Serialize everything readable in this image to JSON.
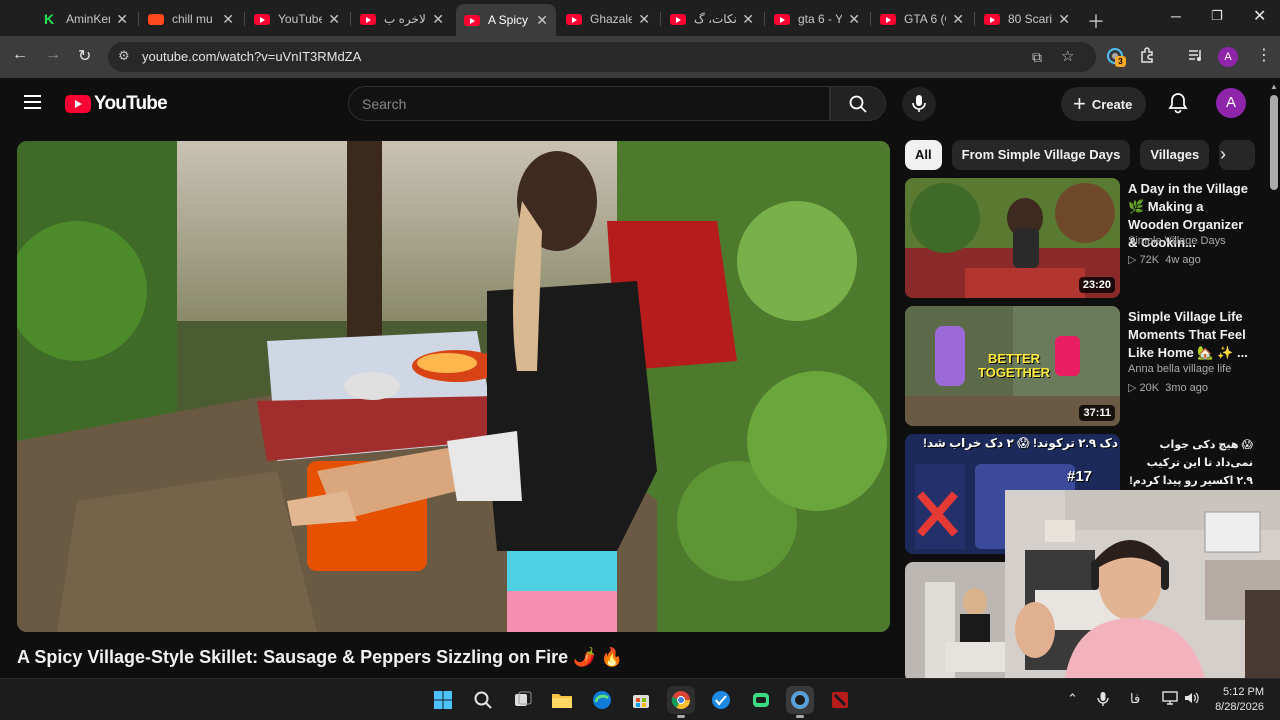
{
  "browser": {
    "tabs": [
      {
        "title": "AminKen",
        "icon": "k-icon"
      },
      {
        "title": "chill mu",
        "icon": "soundcloud-icon"
      },
      {
        "title": "YouTube",
        "icon": "youtube-icon"
      },
      {
        "title": "بالاخره ب",
        "icon": "youtube-icon"
      },
      {
        "title": "A Spicy",
        "icon": "youtube-icon"
      },
      {
        "title": "Ghazale",
        "icon": "youtube-icon"
      },
      {
        "title": "آنکات، گ",
        "icon": "youtube-icon"
      },
      {
        "title": "gta 6 - Y",
        "icon": "youtube-icon"
      },
      {
        "title": "GTA 6 (C",
        "icon": "youtube-icon"
      },
      {
        "title": "80 Scari",
        "icon": "youtube-icon"
      }
    ],
    "active_tab_index": 4,
    "url": "youtube.com/watch?v=uVnIT3RMdZA",
    "extensions_badge": "3",
    "profile_initial": "A"
  },
  "youtube": {
    "logo_text": "YouTube",
    "search_placeholder": "Search",
    "create_label": "Create",
    "avatar_initial": "A",
    "video_title": "A Spicy Village-Style Skillet: Sausage & Peppers Sizzling on Fire 🌶️ 🔥",
    "chips": [
      "All",
      "From Simple Village Days",
      "Villages"
    ],
    "recommendations": [
      {
        "title": "A Day in the Village 🌿 Making a Wooden Organizer & Cookin...",
        "channel": "Simple Village Days",
        "views": "72K",
        "age": "4w ago",
        "duration": "23:20"
      },
      {
        "title": "Simple Village Life Moments That Feel Like Home 🏡 ✨ ...",
        "channel": "Anna bella village life",
        "views": "20K",
        "age": "3mo ago",
        "duration": "37:11",
        "thumb_text": "BETTER TOGETHER"
      },
      {
        "title": "😱 هیچ دکی جواب نمی‌داد تا این ترکیب ۲.۹ اکسیر رو پیدا کردم! | برگشت به رنک ۱۵",
        "thumb_text": "دک ۲.۹ ترکوند! 😱 ۲ دک خراب شد!",
        "thumb_badge": "#17"
      }
    ]
  },
  "taskbar": {
    "time": "5:12 PM",
    "date": "8/28/2026",
    "lang": "فا"
  },
  "colors": {
    "youtube_red": "#ff0033",
    "background": "#0f0f0f",
    "chip_bg": "#272727"
  }
}
